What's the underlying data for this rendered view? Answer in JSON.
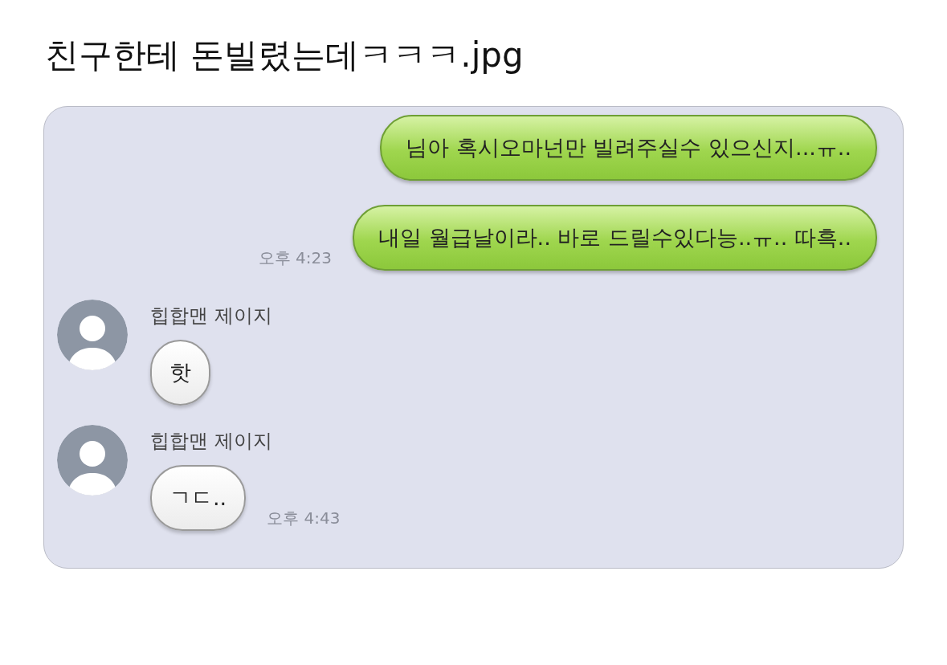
{
  "title": "친구한테 돈빌렸는데ㅋㅋㅋ.jpg",
  "chat": {
    "messages": [
      {
        "kind": "sent",
        "text": "님아 혹시오마넌만 빌려주실수 있으신지...ㅠ.."
      },
      {
        "kind": "sent",
        "text": "내일 월급날이라.. 바로 드릴수있다능..ㅠ.. 따흑..",
        "time": "오후 4:23"
      },
      {
        "kind": "received",
        "sender": "힙합맨 제이지",
        "text": "핫"
      },
      {
        "kind": "received",
        "sender": "힙합맨 제이지",
        "text": "ㄱㄷ..",
        "time": "오후 4:43"
      }
    ]
  }
}
